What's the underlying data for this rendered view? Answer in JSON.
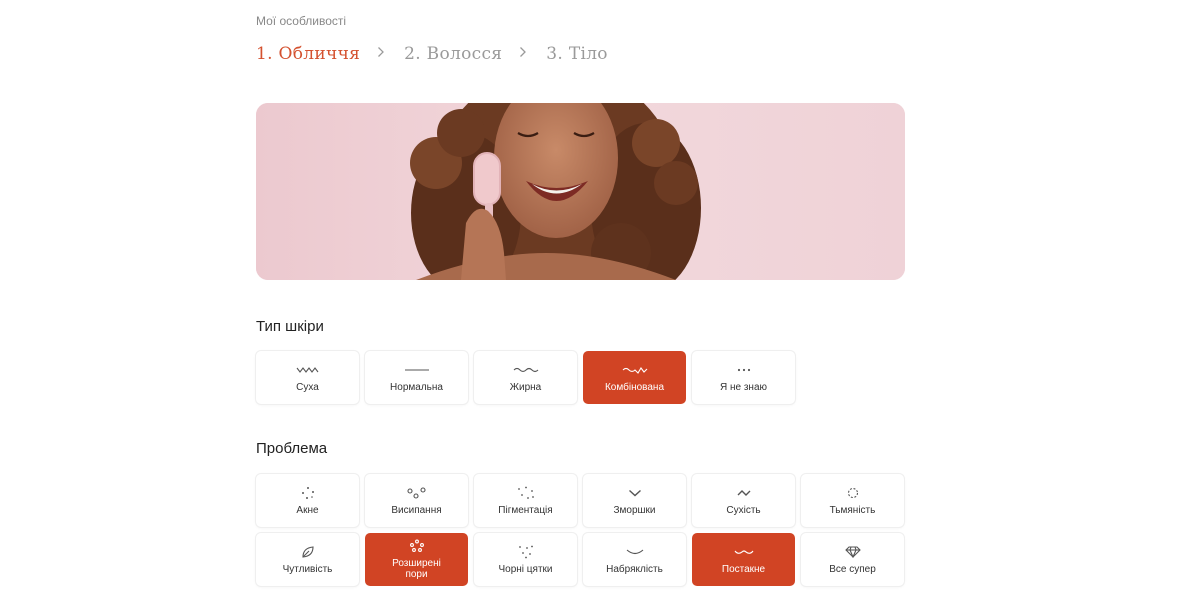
{
  "header": {
    "page_label": "Мої особливості",
    "steps": [
      {
        "label": "1. Обличчя",
        "active": true
      },
      {
        "label": "2. Волосся",
        "active": false
      },
      {
        "label": "3. Тіло",
        "active": false
      }
    ]
  },
  "skin_type": {
    "title": "Тип шкіри",
    "options": [
      {
        "label": "Суха",
        "icon": "squiggle-icon",
        "selected": false
      },
      {
        "label": "Нормальна",
        "icon": "line-icon",
        "selected": false
      },
      {
        "label": "Жирна",
        "icon": "wave-icon",
        "selected": false
      },
      {
        "label": "Комбінована",
        "icon": "wave-mix-icon",
        "selected": true
      },
      {
        "label": "Я не знаю",
        "icon": "ellipsis-icon",
        "selected": false
      }
    ]
  },
  "problem": {
    "title": "Проблема",
    "options": [
      {
        "label": "Акне",
        "icon": "acne-dots-icon",
        "selected": false
      },
      {
        "label": "Висипання",
        "icon": "circles-icon",
        "selected": false
      },
      {
        "label": "Пігментація",
        "icon": "scatter-dots-icon",
        "selected": false
      },
      {
        "label": "Зморшки",
        "icon": "chevron-down-icon",
        "selected": false
      },
      {
        "label": "Сухість",
        "icon": "tilde-icon",
        "selected": false
      },
      {
        "label": "Тьмяність",
        "icon": "dotted-circle-icon",
        "selected": false
      },
      {
        "label": "Чутливість",
        "icon": "leaf-icon",
        "selected": false
      },
      {
        "label": "Розширені пори",
        "icon": "pores-icon",
        "selected": true
      },
      {
        "label": "Чорні цятки",
        "icon": "blackheads-icon",
        "selected": false
      },
      {
        "label": "Набряклість",
        "icon": "curve-icon",
        "selected": false
      },
      {
        "label": "Постакне",
        "icon": "post-acne-icon",
        "selected": true
      },
      {
        "label": "Все супер",
        "icon": "diamond-icon",
        "selected": false
      }
    ]
  },
  "colors": {
    "accent": "#d14424",
    "step_active": "#d4512f",
    "hero_bg": "#efd3d8"
  }
}
